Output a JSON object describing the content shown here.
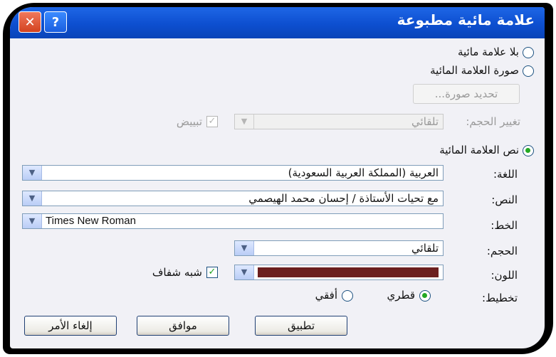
{
  "dialog": {
    "title": "علامة مائية مطبوعة",
    "help_glyph": "?",
    "close_glyph": "✕"
  },
  "options": {
    "no_watermark": "بلا علامة مائية",
    "picture_watermark": "صورة العلامة المائية",
    "select_picture": "تحديد صورة...",
    "scale_label": "تغيير الحجم:",
    "scale_value": "تلقائي",
    "washout_label": "تبييض",
    "text_watermark": "نص العلامة المائية"
  },
  "fields": {
    "language": {
      "label": "اللغة:",
      "value": "العربية (المملكة العربية السعودية)"
    },
    "text": {
      "label": "النص:",
      "value": "مع تحيات الأستاذة / إحسان محمد الهيصمي"
    },
    "font": {
      "label": "الخط:",
      "value": "Times New Roman"
    },
    "size": {
      "label": "الحجم:",
      "value": "تلقائي"
    },
    "color": {
      "label": "اللون:",
      "value": "#6b1f1f"
    },
    "semitransparent": "شبه شفاف",
    "layout": {
      "label": "تخطيط:",
      "diagonal": "قطري",
      "horizontal": "أفقي"
    }
  },
  "buttons": {
    "apply": "تطبيق",
    "ok": "موافق",
    "cancel": "إلغاء الأمر"
  },
  "state": {
    "selected_option": "text_watermark",
    "layout": "diagonal",
    "semitransparent": true,
    "washout": true
  },
  "icons": {
    "combo_arrow": "chevron-down-icon",
    "checkmark": "check-icon"
  }
}
